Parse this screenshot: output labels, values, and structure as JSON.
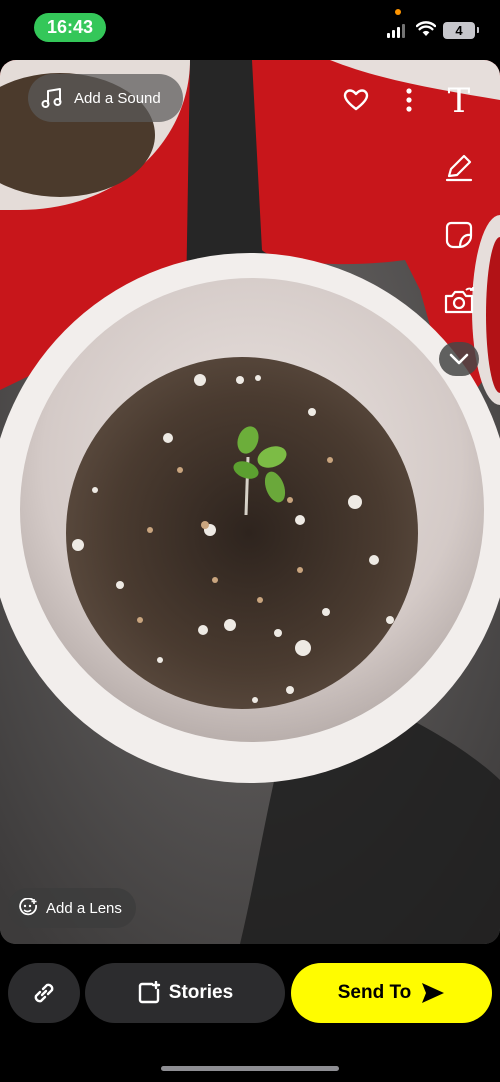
{
  "status_bar": {
    "time": "16:43",
    "battery": "4"
  },
  "snap": {
    "add_sound_label": "Add a Sound",
    "add_lens_label": "Add a Lens"
  },
  "toolbar": {
    "text_tool_label": "T"
  },
  "bottom_bar": {
    "stories_label": "Stories",
    "send_to_label": "Send To"
  },
  "colors": {
    "accent_yellow": "#fffc00",
    "time_pill_green": "#34c759",
    "button_dark": "#2c2c2e"
  }
}
